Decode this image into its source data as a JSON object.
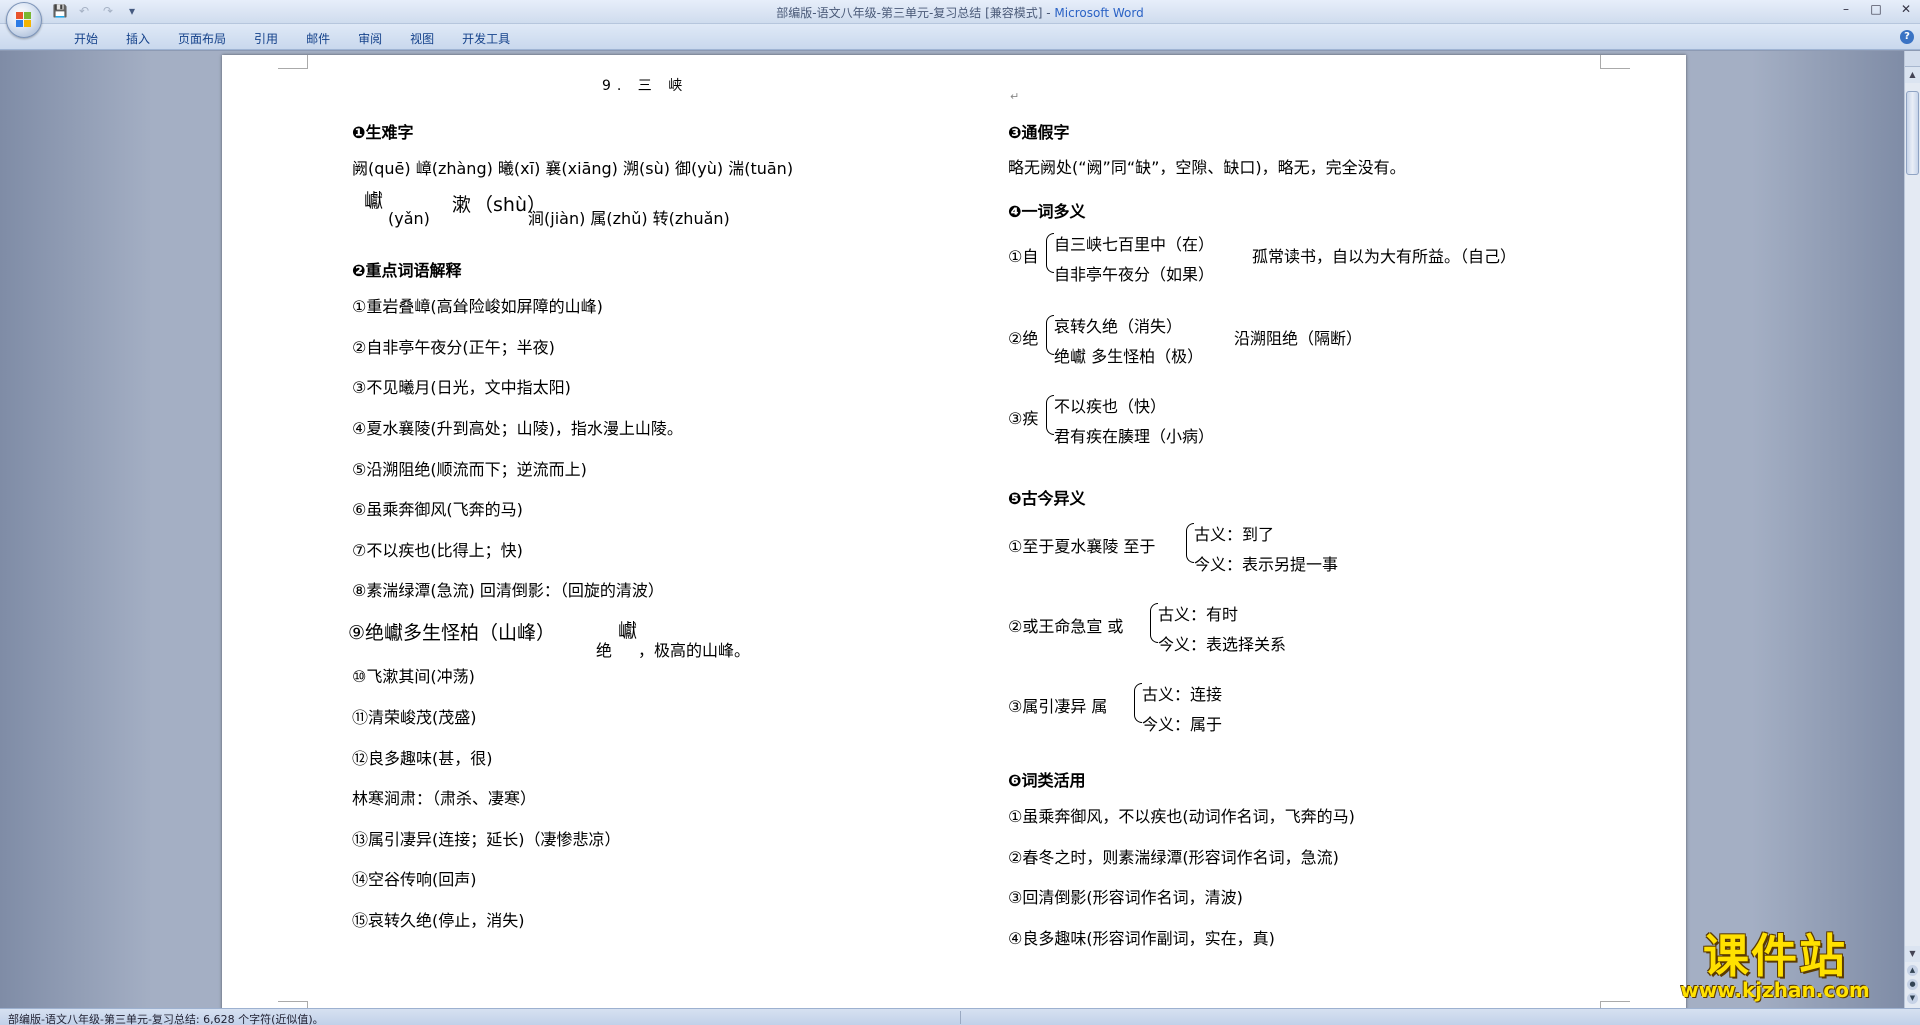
{
  "window": {
    "title": "部编版-语文八年级-第三单元-复习总结 [兼容模式] - ",
    "app_name": "Microsoft Word",
    "controls": [
      "–",
      "□",
      "✕"
    ]
  },
  "qat": {
    "save": "save-icon",
    "undo": "undo-icon",
    "redo": "redo-icon",
    "more": "▾"
  },
  "ribbon": {
    "tabs": [
      "开始",
      "插入",
      "页面布局",
      "引用",
      "邮件",
      "审阅",
      "视图",
      "开发工具"
    ],
    "help": "?"
  },
  "doc": {
    "title": "9. 三  峡",
    "left": {
      "s1_head": "❶生难字",
      "s1_line1": "阙(quē)   嶂(zhàng)   曦(xī)   襄(xiāng)    溯(sù)    御(yù)   湍(tuān)",
      "s1_yan_char": "巘",
      "s1_yan_py": "(yǎn)",
      "s1_shu_char": "漱",
      "s1_shu_py": "（shù）",
      "s1_line2_rest": "涧(jiàn)   属(zhǔ)   转(zhuǎn)",
      "s2_head": "❷重点词语解释",
      "items": [
        "①重岩叠嶂(高耸险峻如屏障的山峰)",
        "②自非亭午夜分(正午；半夜)",
        "③不见曦月(日光，文中指太阳)",
        "④夏水襄陵(升到高处；山陵)，指水漫上山陵。",
        "⑤沿溯阻绝(顺流而下；逆流而上)",
        "⑥虽乘奔御风(飞奔的马)",
        "⑦不以疾也(比得上；快)",
        "⑧素湍绿潭(急流)   回清倒影：（回旋的清波）"
      ],
      "item9_a": "⑨绝巘多生怪柏（山峰）",
      "item9_b": "绝",
      "item9_c": "巘",
      "item9_d": "，极高的山峰。",
      "items2": [
        "⑩飞漱其间(冲荡)",
        "⑪清荣峻茂(茂盛)",
        "⑫良多趣味(甚，很)",
        "林寒涧肃：（肃杀、凄寒）",
        "⑬属引凄异(连接；延长)（凄惨悲凉）",
        "⑭空谷传响(回声)",
        "⑮哀转久绝(停止，消失)"
      ]
    },
    "right": {
      "s3_head": "❸通假字",
      "s3_line": "略无阙处(“阙”同“缺”，空隙、缺口)，略无，完全没有。",
      "s4_head": "❹一词多义",
      "g1": {
        "lead": "①自",
        "r1": "自三峡七百里中（在）",
        "r2": "自非亭午夜分（如果）",
        "tail": "孤常读书，自以为大有所益。（自己）"
      },
      "g2": {
        "lead": "②绝",
        "r1": "哀转久绝（消失）",
        "r2": "绝巘   多生怪柏（极）",
        "tail": "沿溯阻绝（隔断）"
      },
      "g3": {
        "lead": "③疾",
        "r1": "不以疾也（快）",
        "r2": "君有疾在腠理（小病）",
        "tail": ""
      },
      "s5_head": "❺古今异义",
      "g4": {
        "lead": "①至于夏水襄陵    至于",
        "r1": "古义：到了",
        "r2": "今义：表示另提一事"
      },
      "g5": {
        "lead": "②或王命急宣    或",
        "r1": "古义：有时",
        "r2": "今义：表选择关系"
      },
      "g6": {
        "lead": "③属引凄异    属",
        "r1": "古义：连接",
        "r2": "今义：属于"
      },
      "s6_head": "❻词类活用",
      "items": [
        "①虽乘奔御风，不以疾也(动词作名词，飞奔的马)",
        "②春冬之时，则素湍绿潭(形容词作名词，急流)",
        "③回清倒影(形容词作名词，清波)",
        "④良多趣味(形容词作副词，实在，真)"
      ]
    },
    "para_mark": "↵"
  },
  "status": {
    "text": "部编版-语文八年级-第三单元-复习总结: 6,628 个字符(近似值)。"
  },
  "watermark": {
    "main": "课件站",
    "url": "www.kjzhan.com"
  },
  "colors": {
    "accent": "#2a62c5",
    "tab_text": "#15428b",
    "watermark": "#ffe100"
  }
}
